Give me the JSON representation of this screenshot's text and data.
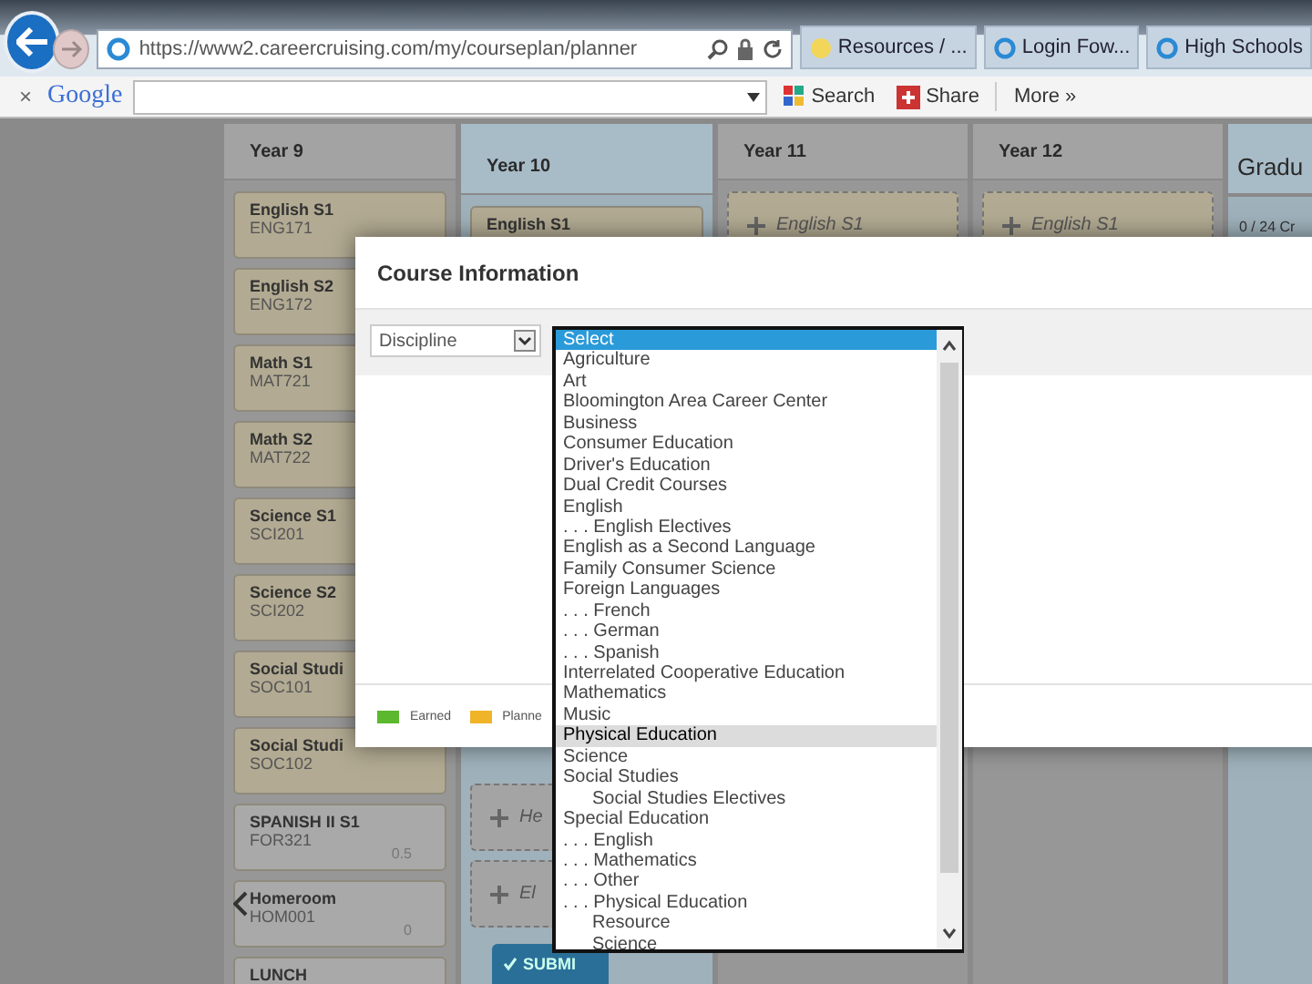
{
  "browser": {
    "url": "https://www2.careercruising.com/my/courseplan/planner",
    "tabs": [
      {
        "label": "Resources / ..."
      },
      {
        "label": "Login   Fow..."
      },
      {
        "label": "High Schools"
      }
    ]
  },
  "toolbar": {
    "close": "×",
    "logo": "Google",
    "search": "Search",
    "share": "Share",
    "more": "More »"
  },
  "planner": {
    "columns": [
      {
        "title": "Year 9",
        "kind": "year",
        "highlight": false,
        "items": [
          {
            "kind": "course",
            "name": "English S1",
            "code": "ENG171"
          },
          {
            "kind": "course",
            "name": "English S2",
            "code": "ENG172"
          },
          {
            "kind": "course",
            "name": "Math S1",
            "code": "MAT721"
          },
          {
            "kind": "course",
            "name": "Math S2",
            "code": "MAT722"
          },
          {
            "kind": "course",
            "name": "Science S1",
            "code": "SCI201"
          },
          {
            "kind": "course",
            "name": "Science S2",
            "code": "SCI202"
          },
          {
            "kind": "course",
            "name": "Social Studi",
            "code": "SOC101"
          },
          {
            "kind": "course",
            "name": "Social Studi",
            "code": "SOC102"
          },
          {
            "kind": "other",
            "name": "SPANISH II S1",
            "code": "FOR321",
            "credits": "0.5"
          },
          {
            "kind": "other",
            "name": "Homeroom",
            "code": "HOM001",
            "credits": "0"
          },
          {
            "kind": "other",
            "name": "LUNCH"
          }
        ]
      },
      {
        "title": "Year 10",
        "kind": "year",
        "highlight": true,
        "items": [
          {
            "kind": "course",
            "name": "English S1"
          },
          {
            "kind": "spacer"
          },
          {
            "kind": "slot",
            "name": "He"
          },
          {
            "kind": "slot",
            "name": "El"
          }
        ],
        "button": "SUBMI"
      },
      {
        "title": "Year 11",
        "kind": "year",
        "highlight": false,
        "items": [
          {
            "kind": "slot",
            "name": "English S1"
          }
        ]
      },
      {
        "title": "Year 12",
        "kind": "year",
        "highlight": false,
        "items": [
          {
            "kind": "slot",
            "name": "English S1"
          }
        ]
      },
      {
        "title": "Gradu",
        "kind": "grad",
        "highlight": true,
        "summary": "0 / 24 Cr"
      }
    ]
  },
  "dialog": {
    "title": "Course Information",
    "filter": "Discipline",
    "legend": [
      {
        "label": "Earned",
        "color": "#5cb82e"
      },
      {
        "label": "Planne",
        "color": "#f0b429"
      }
    ]
  },
  "listbox": {
    "options": [
      {
        "label": "Select",
        "kind": "option",
        "selected": true,
        "hovered": false
      },
      {
        "label": "Agriculture",
        "kind": "option",
        "selected": false,
        "hovered": false
      },
      {
        "label": "Art",
        "kind": "option",
        "selected": false,
        "hovered": false
      },
      {
        "label": "Bloomington Area Career Center",
        "kind": "option",
        "selected": false,
        "hovered": false
      },
      {
        "label": "Business",
        "kind": "option",
        "selected": false,
        "hovered": false
      },
      {
        "label": "Consumer Education",
        "kind": "option",
        "selected": false,
        "hovered": false
      },
      {
        "label": "Driver's Education",
        "kind": "option",
        "selected": false,
        "hovered": false
      },
      {
        "label": "Dual Credit Courses",
        "kind": "option",
        "selected": false,
        "hovered": false
      },
      {
        "label": "English",
        "kind": "option",
        "selected": false,
        "hovered": false
      },
      {
        "label": ". . . English Electives",
        "kind": "option",
        "selected": false,
        "hovered": false
      },
      {
        "label": "English as a Second Language",
        "kind": "option",
        "selected": false,
        "hovered": false
      },
      {
        "label": "Family Consumer Science",
        "kind": "option",
        "selected": false,
        "hovered": false
      },
      {
        "label": "Foreign Languages",
        "kind": "option",
        "selected": false,
        "hovered": false
      },
      {
        "label": ". . . French",
        "kind": "option",
        "selected": false,
        "hovered": false
      },
      {
        "label": ". . . German",
        "kind": "option",
        "selected": false,
        "hovered": false
      },
      {
        "label": ". . . Spanish",
        "kind": "option",
        "selected": false,
        "hovered": false
      },
      {
        "label": "Interrelated Cooperative Education",
        "kind": "option",
        "selected": false,
        "hovered": false
      },
      {
        "label": "Mathematics",
        "kind": "option",
        "selected": false,
        "hovered": false
      },
      {
        "label": "Music",
        "kind": "option",
        "selected": false,
        "hovered": false
      },
      {
        "label": "Physical Education",
        "kind": "option",
        "selected": false,
        "hovered": true
      },
      {
        "label": "Science",
        "kind": "option",
        "selected": false,
        "hovered": false
      },
      {
        "label": "Social Studies",
        "kind": "option",
        "selected": false,
        "hovered": false
      },
      {
        "label": "Social Studies Electives",
        "kind": "indented",
        "selected": false,
        "hovered": false
      },
      {
        "label": "Special Education",
        "kind": "option",
        "selected": false,
        "hovered": false
      },
      {
        "label": ". . . English",
        "kind": "option",
        "selected": false,
        "hovered": false
      },
      {
        "label": ". . . Mathematics",
        "kind": "option",
        "selected": false,
        "hovered": false
      },
      {
        "label": ". . . Other",
        "kind": "option",
        "selected": false,
        "hovered": false
      },
      {
        "label": ". . . Physical Education",
        "kind": "option",
        "selected": false,
        "hovered": false
      },
      {
        "label": "Resource",
        "kind": "indented",
        "selected": false,
        "hovered": false
      },
      {
        "label": "Science",
        "kind": "indented",
        "selected": false,
        "hovered": false
      }
    ]
  }
}
